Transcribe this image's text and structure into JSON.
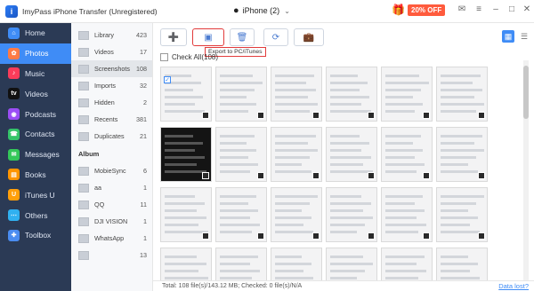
{
  "app": {
    "title": "ImyPass iPhone Transfer (Unregistered)",
    "logo_letter": "i"
  },
  "device": {
    "name": "iPhone (2)"
  },
  "promo": {
    "badge": "20% OFF"
  },
  "sidebar": {
    "items": [
      {
        "label": "Home",
        "icon": "home-icon",
        "color": "#3f8cf6",
        "glyph": "⌂"
      },
      {
        "label": "Photos",
        "icon": "photos-icon",
        "color": "#ff7a45",
        "glyph": "✿",
        "active": true
      },
      {
        "label": "Music",
        "icon": "music-icon",
        "color": "#fa3c5a",
        "glyph": "♪"
      },
      {
        "label": "Videos",
        "icon": "videos-icon",
        "color": "#111111",
        "glyph": "tv"
      },
      {
        "label": "Podcasts",
        "icon": "podcasts-icon",
        "color": "#9b4df5",
        "glyph": "◉"
      },
      {
        "label": "Contacts",
        "icon": "contacts-icon",
        "color": "#35c46a",
        "glyph": "☎"
      },
      {
        "label": "Messages",
        "icon": "messages-icon",
        "color": "#34c759",
        "glyph": "✉"
      },
      {
        "label": "Books",
        "icon": "books-icon",
        "color": "#ff9500",
        "glyph": "▤"
      },
      {
        "label": "iTunes U",
        "icon": "itunes-u-icon",
        "color": "#ff9f0a",
        "glyph": "U"
      },
      {
        "label": "Others",
        "icon": "others-icon",
        "color": "#30b0f0",
        "glyph": "⋯"
      },
      {
        "label": "Toolbox",
        "icon": "toolbox-icon",
        "color": "#4a8cf0",
        "glyph": "✚"
      }
    ]
  },
  "categories": {
    "items": [
      {
        "label": "Library",
        "count": "423"
      },
      {
        "label": "Videos",
        "count": "17"
      },
      {
        "label": "Screenshots",
        "count": "108",
        "active": true
      },
      {
        "label": "Imports",
        "count": "32"
      },
      {
        "label": "Hidden",
        "count": "2"
      },
      {
        "label": "Recents",
        "count": "381"
      },
      {
        "label": "Duplicates",
        "count": "21"
      }
    ],
    "album_heading": "Album",
    "albums": [
      {
        "label": "MobieSync",
        "count": "6"
      },
      {
        "label": "aa",
        "count": "1"
      },
      {
        "label": "QQ",
        "count": "11"
      },
      {
        "label": "DJI VISION",
        "count": "1"
      },
      {
        "label": "WhatsApp",
        "count": "1"
      },
      {
        "label": "",
        "count": "13"
      }
    ]
  },
  "toolbar": {
    "export_tooltip": "Export to PC/iTunes"
  },
  "checkall": {
    "label": "Check All(108)"
  },
  "status": {
    "summary": "Total: 108 file(s)/143.12 MB; Checked: 0 file(s)/N/A",
    "data_lost": "Data lost?"
  }
}
